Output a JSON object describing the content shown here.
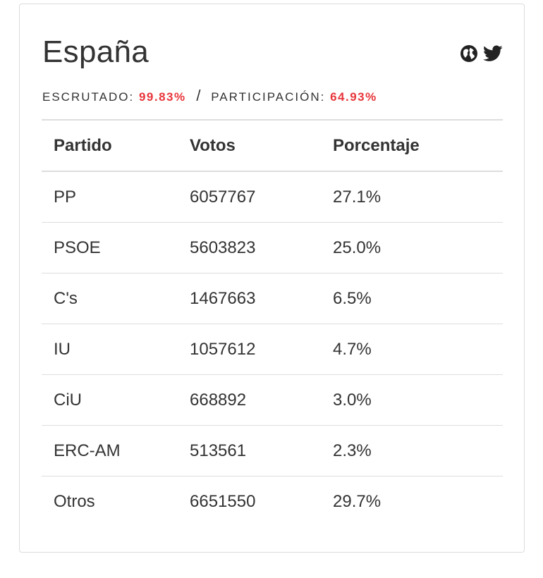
{
  "region": {
    "title": "España"
  },
  "stats": {
    "escrutado_label": "ESCRUTADO:",
    "escrutado_value": "99.83%",
    "separator": "/",
    "participacion_label": "PARTICIPACIÓN:",
    "participacion_value": "64.93%"
  },
  "icons": {
    "globe": "globe-icon",
    "twitter": "twitter-icon"
  },
  "colors": {
    "accent": "#e8363b",
    "text": "#333333",
    "border": "#dddddd"
  },
  "table": {
    "headers": [
      "Partido",
      "Votos",
      "Porcentaje"
    ],
    "rows": [
      {
        "party": "PP",
        "votes": "6057767",
        "percent": "27.1%"
      },
      {
        "party": "PSOE",
        "votes": "5603823",
        "percent": "25.0%"
      },
      {
        "party": "C's",
        "votes": "1467663",
        "percent": "6.5%"
      },
      {
        "party": "IU",
        "votes": "1057612",
        "percent": "4.7%"
      },
      {
        "party": "CiU",
        "votes": "668892",
        "percent": "3.0%"
      },
      {
        "party": "ERC-AM",
        "votes": "513561",
        "percent": "2.3%"
      },
      {
        "party": "Otros",
        "votes": "6651550",
        "percent": "29.7%"
      }
    ]
  }
}
